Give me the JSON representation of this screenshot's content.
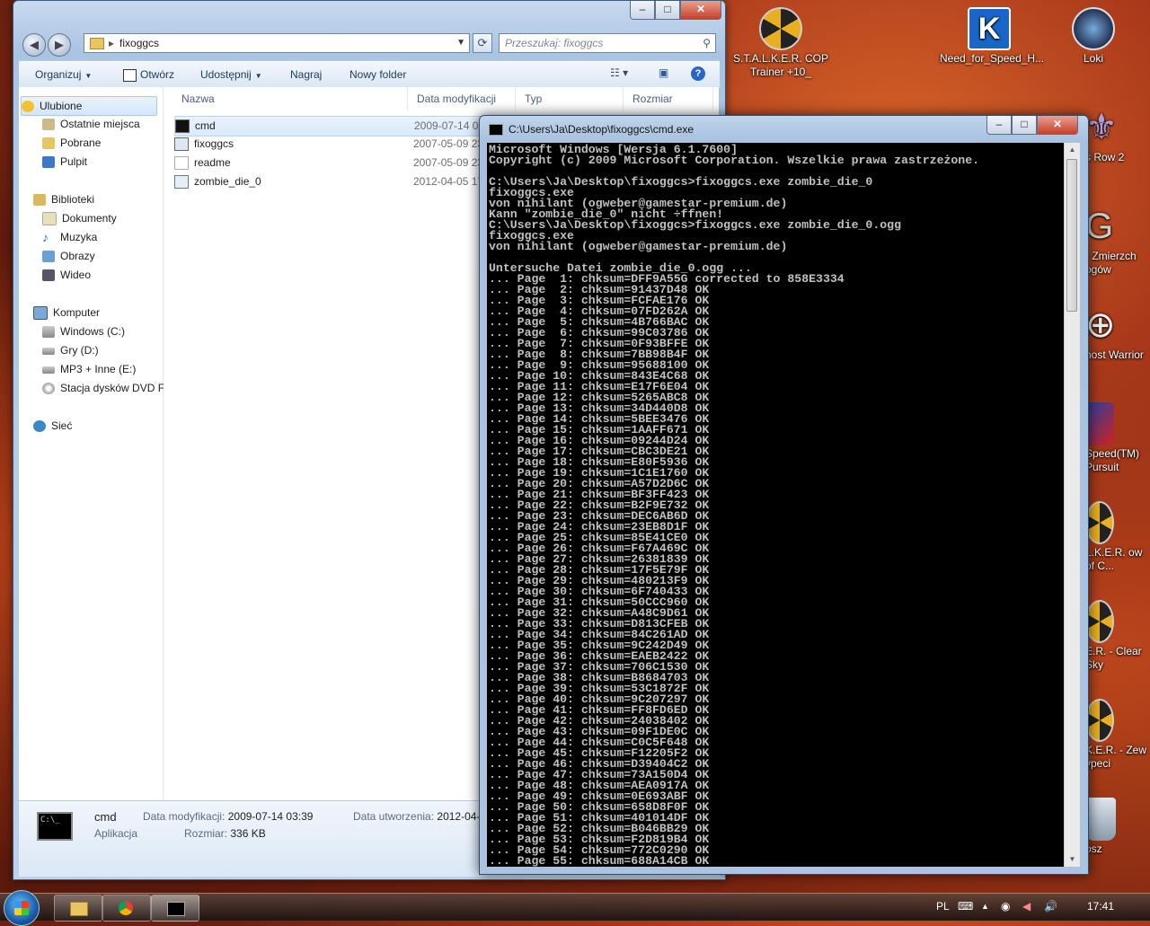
{
  "desktop": {
    "icons": [
      {
        "label": "S.T.A.L.K.E.R. COP Trainer +10_",
        "icon": "radiation-icon"
      },
      {
        "label": "Need_for_Speed_H...",
        "icon": "kaspersky-k-icon"
      },
      {
        "label": "Loki",
        "icon": "loki-game-icon"
      },
      {
        "label": "s Row 2",
        "icon": "fleur-de-lis-icon"
      },
      {
        "label": "- Zmierzch ogów",
        "icon": "game-icon"
      },
      {
        "label": "host Warrior",
        "icon": "crosshair-icon"
      },
      {
        "label": "Speed(TM) Pursuit",
        "icon": "car-icon"
      },
      {
        "label": "L.K.E.R. ow of C...",
        "icon": "radiation-icon"
      },
      {
        "label": "E.R. - Clear Sky",
        "icon": "radiation-icon"
      },
      {
        "label": "K.E.R. - Zew ypeci",
        "icon": "radiation-icon"
      },
      {
        "label": "osz",
        "icon": "recycle-bin-icon"
      }
    ]
  },
  "explorer": {
    "breadcrumb": "fixoggcs",
    "search_placeholder": "Przeszukaj: fixoggcs",
    "toolbar": {
      "organize": "Organizuj",
      "open": "Otwórz",
      "share": "Udostępnij",
      "burn": "Nagraj",
      "new_folder": "Nowy folder"
    },
    "nav": {
      "favorites": "Ulubione",
      "recent": "Ostatnie miejsca",
      "downloads": "Pobrane",
      "desktop": "Pulpit",
      "libraries": "Biblioteki",
      "documents": "Dokumenty",
      "music": "Muzyka",
      "pictures": "Obrazy",
      "videos": "Wideo",
      "computer": "Komputer",
      "drive_c": "Windows (C:)",
      "drive_d": "Gry (D:)",
      "drive_e": "MP3 + Inne (E:)",
      "dvd": "Stacja dysków DVD F",
      "network": "Sieć"
    },
    "columns": {
      "name": "Nazwa",
      "modified": "Data modyfikacji",
      "type": "Typ",
      "size": "Rozmiar"
    },
    "files": [
      {
        "name": "cmd",
        "date": "2009-07-14 03:"
      },
      {
        "name": "fixoggcs",
        "date": "2007-05-09 23:"
      },
      {
        "name": "readme",
        "date": "2007-05-09 23:"
      },
      {
        "name": "zombie_die_0",
        "date": "2012-04-05 17:"
      }
    ],
    "details": {
      "name": "cmd",
      "kind": "Aplikacja",
      "modified_label": "Data modyfikacji:",
      "modified_value": "2009-07-14 03:39",
      "size_label": "Rozmiar:",
      "size_value": "336 KB",
      "created_label": "Data utworzenia:",
      "created_value": "2012-04-05"
    }
  },
  "cmd": {
    "title": "C:\\Users\\Ja\\Desktop\\fixoggcs\\cmd.exe",
    "output": "Microsoft Windows [Wersja 6.1.7600]\nCopyright (c) 2009 Microsoft Corporation. Wszelkie prawa zastrzeżone.\n\nC:\\Users\\Ja\\Desktop\\fixoggcs>fixoggcs.exe zombie_die_0\nfixoggcs.exe\nvon nihilant (ogweber@gamestar-premium.de)\nKann \"zombie_die_0\" nicht ÷ffnen!\nC:\\Users\\Ja\\Desktop\\fixoggcs>fixoggcs.exe zombie_die_0.ogg\nfixoggcs.exe\nvon nihilant (ogweber@gamestar-premium.de)\n\nUntersuche Datei zombie_die_0.ogg ...\n... Page  1: chksum=DFF9A55G corrected to 858E3334\n... Page  2: chksum=91437D48 OK\n... Page  3: chksum=FCFAE176 OK\n... Page  4: chksum=07FD262A OK\n... Page  5: chksum=4B766BAC OK\n... Page  6: chksum=99C03786 OK\n... Page  7: chksum=0F93BFFE OK\n... Page  8: chksum=7BB98B4F OK\n... Page  9: chksum=95688100 OK\n... Page 10: chksum=843E4C68 OK\n... Page 11: chksum=E17F6E04 OK\n... Page 12: chksum=5265ABC8 OK\n... Page 13: chksum=34D440D8 OK\n... Page 14: chksum=5BEE3476 OK\n... Page 15: chksum=1AAFF671 OK\n... Page 16: chksum=09244D24 OK\n... Page 17: chksum=CBC3DE21 OK\n... Page 18: chksum=E80F5936 OK\n... Page 19: chksum=1C1E1760 OK\n... Page 20: chksum=A57D2D6C OK\n... Page 21: chksum=BF3FF423 OK\n... Page 22: chksum=B2F9E732 OK\n... Page 23: chksum=DEC6AB6D OK\n... Page 24: chksum=23EB8D1F OK\n... Page 25: chksum=85E41CE0 OK\n... Page 26: chksum=F67A469C OK\n... Page 27: chksum=26381839 OK\n... Page 28: chksum=17F5E79F OK\n... Page 29: chksum=480213F9 OK\n... Page 30: chksum=6F740433 OK\n... Page 31: chksum=50CCC960 OK\n... Page 32: chksum=A48C9D61 OK\n... Page 33: chksum=D813CFEB OK\n... Page 34: chksum=84C261AD OK\n... Page 35: chksum=9C242D49 OK\n... Page 36: chksum=EAEB2422 OK\n... Page 37: chksum=706C1530 OK\n... Page 38: chksum=B8684703 OK\n... Page 39: chksum=53C1872F OK\n... Page 40: chksum=9C207297 OK\n... Page 41: chksum=FF8FD6ED OK\n... Page 42: chksum=24038402 OK\n... Page 43: chksum=09F1DE0C OK\n... Page 44: chksum=C0C5F648 OK\n... Page 45: chksum=F12205F2 OK\n... Page 46: chksum=D39404C2 OK\n... Page 47: chksum=73A150D4 OK\n... Page 48: chksum=AEA0917A OK\n... Page 49: chksum=0E693ABF OK\n... Page 50: chksum=658D8F0F OK\n... Page 51: chksum=401014DF OK\n... Page 52: chksum=B046BB29 OK\n... Page 53: chksum=F2D819B4 OK\n... Page 54: chksum=772C0290 OK\n... Page 55: chksum=688A14CB OK"
  },
  "taskbar": {
    "language": "PL",
    "clock": "17:41"
  }
}
